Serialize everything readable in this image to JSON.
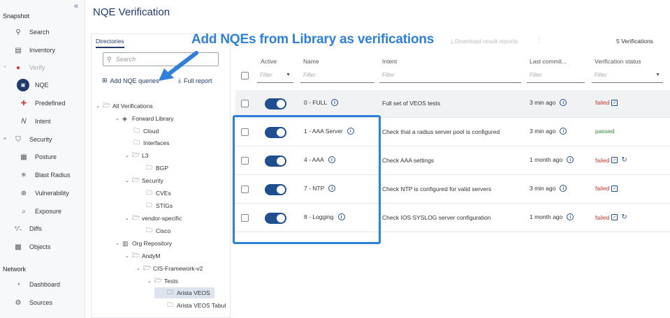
{
  "nav": {
    "collapse_icon": "double-chevron-left-icon",
    "snapshot_title": "Snapshot",
    "network_title": "Network",
    "items": [
      {
        "label": "Search",
        "icon": "search-icon"
      },
      {
        "label": "Inventory",
        "icon": "inventory-icon"
      },
      {
        "label": "Verify",
        "icon": "verify-icon"
      },
      {
        "label": "NQE",
        "icon": "nqe-icon"
      },
      {
        "label": "Predefined",
        "icon": "predefined-icon"
      },
      {
        "label": "Intent",
        "icon": "intent-icon"
      },
      {
        "label": "Security",
        "icon": "shield-icon"
      },
      {
        "label": "Posture",
        "icon": "posture-icon"
      },
      {
        "label": "Blast Radius",
        "icon": "blast-radius-icon"
      },
      {
        "label": "Vulnerability",
        "icon": "vulnerability-icon"
      },
      {
        "label": "Exposure",
        "icon": "exposure-icon"
      },
      {
        "label": "Diffs",
        "icon": "diffs-icon"
      },
      {
        "label": "Objects",
        "icon": "objects-icon"
      },
      {
        "label": "Dashboard",
        "icon": "dashboard-icon"
      },
      {
        "label": "Sources",
        "icon": "sources-icon"
      }
    ]
  },
  "page": {
    "title": "NQE Verification"
  },
  "directories": {
    "tab": "Directories",
    "search_placeholder": "Search",
    "add_label": "Add NQE queries",
    "report_label": "Full report",
    "tree": [
      {
        "label": "All Verifications"
      },
      {
        "label": "Forward Library"
      },
      {
        "label": "Cloud"
      },
      {
        "label": "Interfaces"
      },
      {
        "label": "L3"
      },
      {
        "label": "BGP"
      },
      {
        "label": "Security"
      },
      {
        "label": "CVEs"
      },
      {
        "label": "STIGs"
      },
      {
        "label": "vendor-specific"
      },
      {
        "label": "Cisco"
      },
      {
        "label": "Org Repository"
      },
      {
        "label": "AndyM"
      },
      {
        "label": "CIS-Framework-v2"
      },
      {
        "label": "Tests"
      },
      {
        "label": "Arista VEOS"
      },
      {
        "label": "Arista VEOS Tabul"
      }
    ]
  },
  "toolbar": {
    "download_label": "Download result reports",
    "count_label": "5 Verifications"
  },
  "table": {
    "headers": {
      "active": "Active",
      "name": "Name",
      "intent": "Intent",
      "last_commit": "Last commit...",
      "status": "Verification status"
    },
    "filter_placeholder": "Filter",
    "rows": [
      {
        "name": "0 - FULL",
        "intent": "Full set of VEOS tests",
        "last": "3 min ago",
        "status": "failed"
      },
      {
        "name": "1 - AAA Server",
        "intent": "Check that a radius server pool is configured",
        "last": "3 min ago",
        "status": "passed"
      },
      {
        "name": "4 - AAA",
        "intent": "Check AAA settings",
        "last": "1 month ago",
        "status": "failed"
      },
      {
        "name": "7 - NTP",
        "intent": "Check NTP is configured for valid servers",
        "last": "3 min ago",
        "status": "failed"
      },
      {
        "name": "8 - Logging",
        "intent": "Check IOS SYSLOG server configuration",
        "last": "1 month ago",
        "status": "failed"
      }
    ]
  },
  "annotation": {
    "callout": "Add NQEs from Library as verifications",
    "color": "#2f7fdc"
  },
  "colors": {
    "accent": "#1f3a6b",
    "toggle": "#1f4f91",
    "failed": "#c0392b",
    "passed": "#2e8b3a"
  }
}
